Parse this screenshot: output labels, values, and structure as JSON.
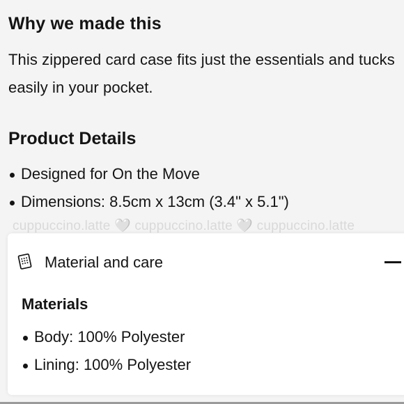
{
  "why": {
    "heading": "Why we made this",
    "body": "This zippered card case fits just the essentials and tucks easily in your pocket."
  },
  "details": {
    "heading": "Product Details",
    "items": [
      "Designed for On the Move",
      "Dimensions: 8.5cm x 13cm (3.4\" x 5.1\")"
    ]
  },
  "watermark": "cuppuccino.latte 🤍 cuppuccino.latte 🤍 cuppuccino.latte",
  "accordion": {
    "title": "Material and care",
    "expanded": true,
    "icon": "fabric-tag-icon",
    "toggle_icon": "minus-icon"
  },
  "materials": {
    "heading": "Materials",
    "items": [
      "Body: 100% Polyester",
      "Lining: 100% Polyester"
    ]
  }
}
